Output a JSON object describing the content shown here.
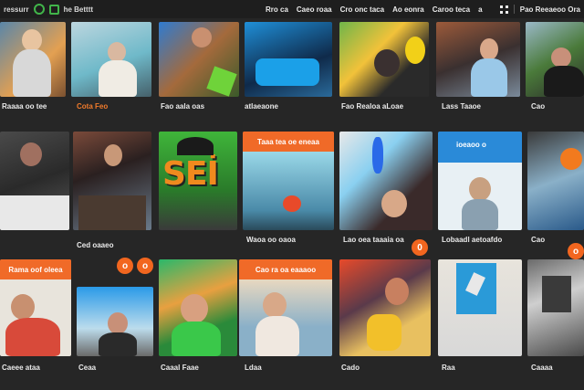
{
  "topbar": {
    "app_name": "ressurr",
    "brand_label": "he Betttt",
    "nav_items": [
      "Rro ca",
      "Caeo roaa",
      "Cro onc taca",
      "Ao eonra",
      "Caroo teca",
      "a"
    ],
    "right_label": "Pao Reeaeoo Ora"
  },
  "tiles": [
    {
      "label": "Raaaa oo tee",
      "badge": null
    },
    {
      "label": "Cota Feo",
      "badge": null,
      "orange": true
    },
    {
      "label": "Fao aala oas",
      "badge": null
    },
    {
      "label": "atlaeaone",
      "badge": null
    },
    {
      "label": "Fao Realoa aLoae",
      "badge": null
    },
    {
      "label": "Lass Taaoe",
      "badge": null
    },
    {
      "label": "Cao",
      "badge": null
    },
    {
      "label": "Ced oaaeo",
      "badge": null
    },
    {
      "label": "",
      "badge": null
    },
    {
      "label": "",
      "badge": null,
      "big_text": "SEİ"
    },
    {
      "label": "Waoa oo oaoa",
      "badge": null,
      "bar": "Taaa tea oe eneaa"
    },
    {
      "label": "Lao oea taaaia oa",
      "badge": "0"
    },
    {
      "label": "Lobaadl aetoafdo",
      "badge": null
    },
    {
      "label": "Cao",
      "badge": null
    },
    {
      "label": "Caeee ataa",
      "badge": null,
      "bar": "Rama oof oleea"
    },
    {
      "label": "Ceaa",
      "badge": "o"
    },
    {
      "label": "Caaal Faae",
      "badge": null
    },
    {
      "label": "Ldaa",
      "badge": null,
      "bar": "Cao ra oa eaaaoo"
    },
    {
      "label": "Cado",
      "badge": null
    },
    {
      "label": "Raa",
      "badge": null
    },
    {
      "label": "Caaaa",
      "badge": null
    }
  ],
  "extra_badges": [
    "o",
    "o"
  ],
  "colors": {
    "accent": "#f06a28",
    "brand": "#41b54a",
    "background": "#262626"
  }
}
